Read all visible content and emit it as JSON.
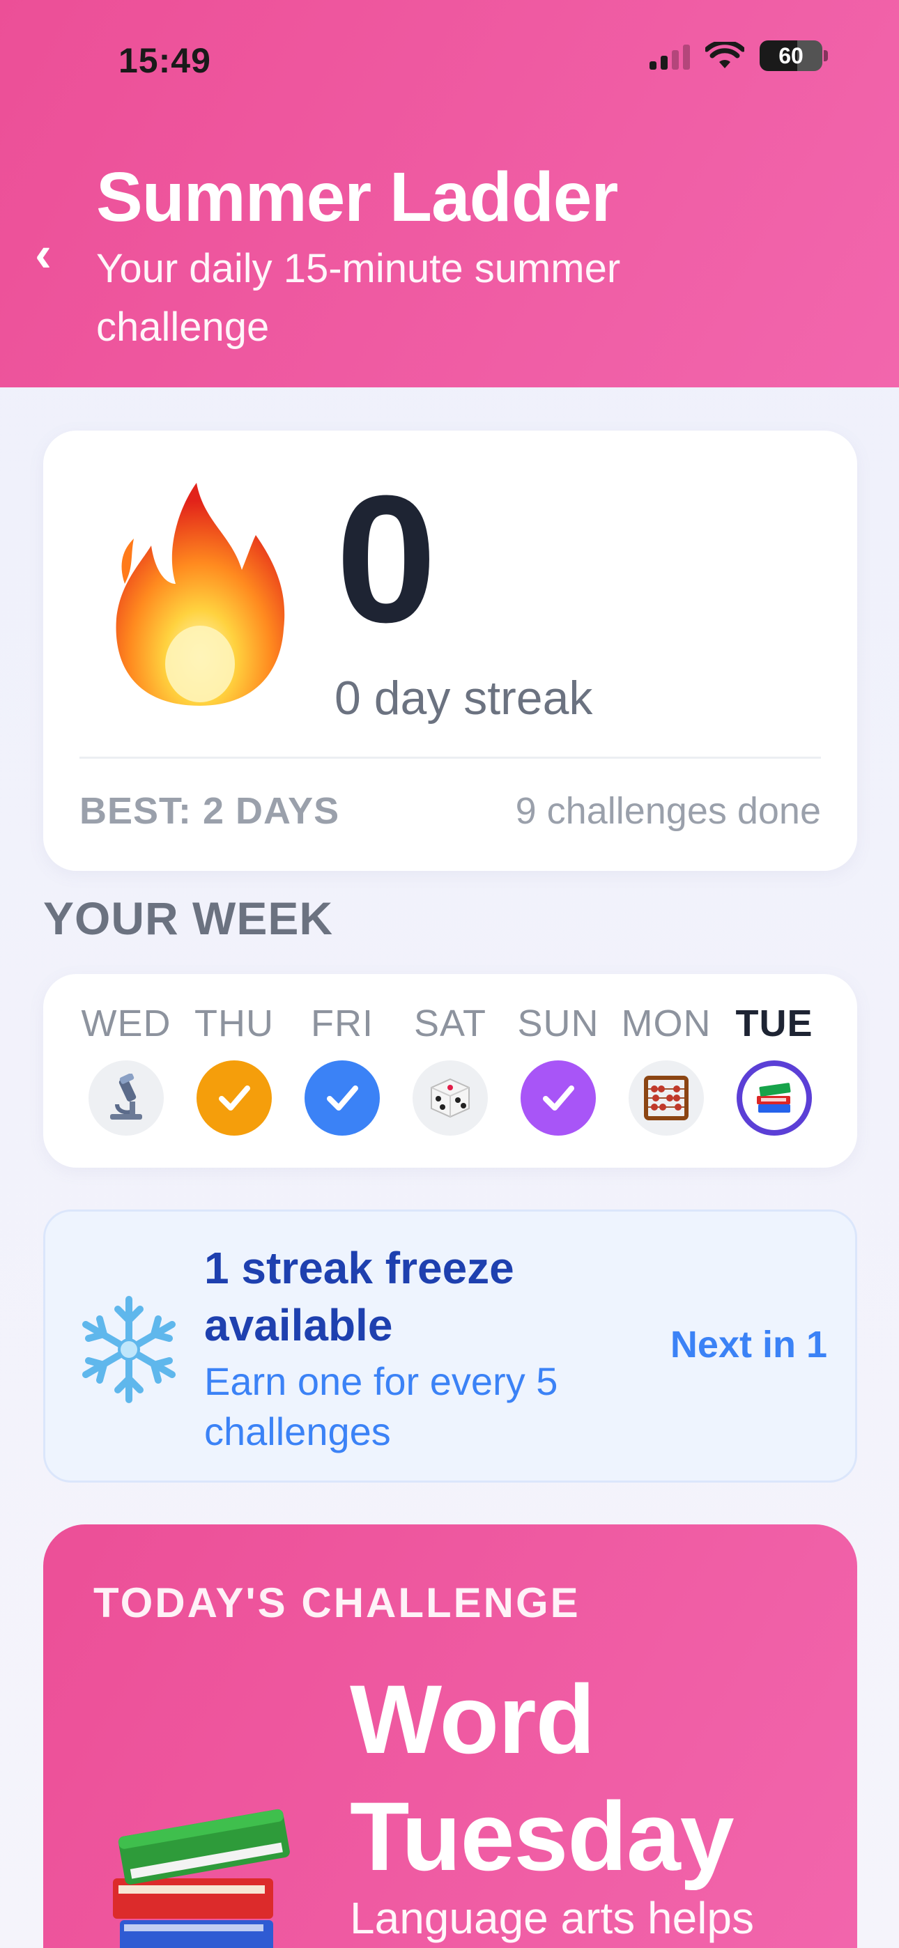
{
  "status_bar": {
    "time": "15:49",
    "battery": "60",
    "battery_level": 0.6
  },
  "header": {
    "title": "Summer Ladder",
    "subtitle": "Your daily 15-minute summer challenge"
  },
  "streak": {
    "count": "0",
    "label": "0 day streak",
    "best": "BEST: 2 DAYS",
    "challenges_done": "9 challenges done"
  },
  "week": {
    "section_label": "YOUR WEEK",
    "days": [
      {
        "name": "WED",
        "state": "microscope"
      },
      {
        "name": "THU",
        "state": "done"
      },
      {
        "name": "FRI",
        "state": "done"
      },
      {
        "name": "SAT",
        "state": "dice"
      },
      {
        "name": "SUN",
        "state": "done"
      },
      {
        "name": "MON",
        "state": "abacus"
      },
      {
        "name": "TUE",
        "state": "today"
      }
    ]
  },
  "freeze": {
    "title": "1 streak freeze available",
    "subtitle": "Earn one for every 5 challenges",
    "next": "Next in 1"
  },
  "challenge": {
    "eyebrow": "TODAY'S CHALLENGE",
    "title": "Word Tuesday",
    "subtitle": "Language arts helps"
  },
  "colors": {
    "brand_pink": "#ec4f97",
    "orange": "#f59e0b",
    "blue": "#3b82f6",
    "purple": "#a855f7",
    "today_ring": "#5b3fd6"
  }
}
